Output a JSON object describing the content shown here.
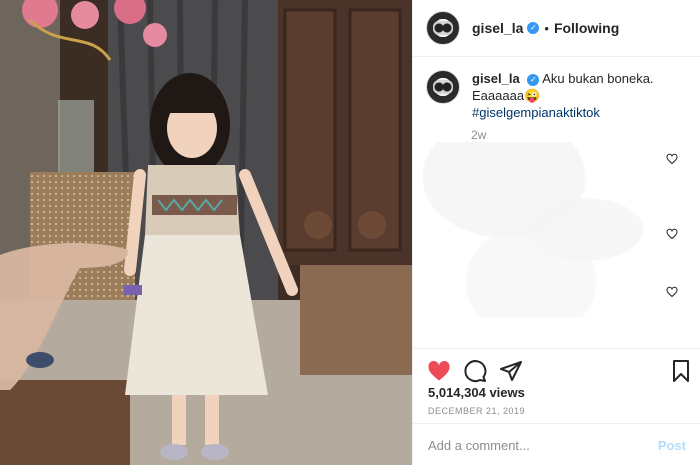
{
  "post": {
    "username": "gisel_la",
    "verified_mark": "✓",
    "separator": "•",
    "follow_status": "Following"
  },
  "caption": {
    "username": "gisel_la",
    "text_line1": "Aku bukan boneka.",
    "text_line2": "Eaaaaaa😜",
    "hashtag": "#giselgempianaktiktok",
    "time_ago": "2w"
  },
  "comment_likes": [
    {
      "icon": "heart-outline-icon"
    },
    {
      "icon": "heart-outline-icon"
    },
    {
      "icon": "heart-outline-icon"
    }
  ],
  "actions": {
    "like_icon": "heart-filled-icon",
    "comment_icon": "comment-icon",
    "share_icon": "share-icon",
    "save_icon": "bookmark-icon",
    "views": "5,014,304 views",
    "date": "DECEMBER 21, 2019"
  },
  "composer": {
    "placeholder": "Add a comment...",
    "post_label": "Post"
  },
  "colors": {
    "like_red": "#ed4956",
    "link_blue": "#003569",
    "verified_blue": "#3897f0",
    "post_disabled": "#b2dffc"
  }
}
